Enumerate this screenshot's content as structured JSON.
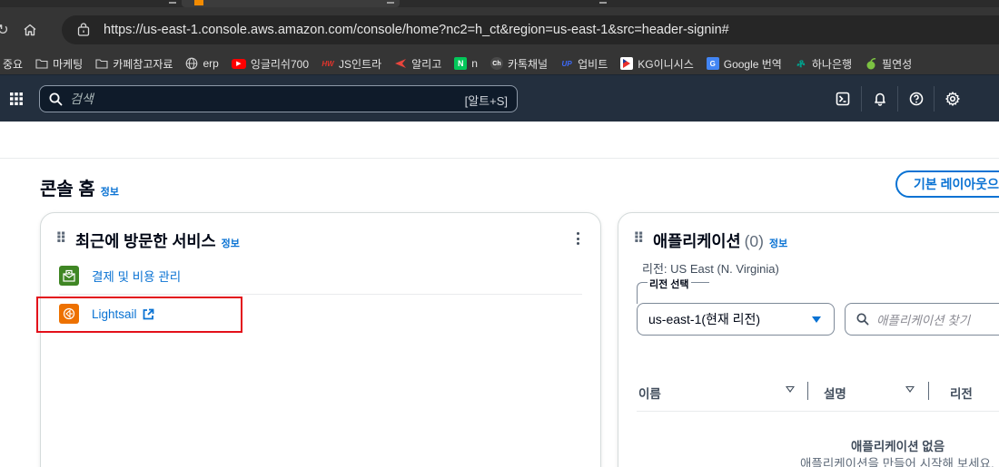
{
  "browser": {
    "url": "https://us-east-1.console.aws.amazon.com/console/home?nc2=h_ct&region=us-east-1&src=header-signin#",
    "bookmarks": [
      {
        "label": "중요",
        "icon": "none"
      },
      {
        "label": "마케팅",
        "icon": "folder-icon"
      },
      {
        "label": "카페참고자료",
        "icon": "folder-icon"
      },
      {
        "label": "erp",
        "icon": "globe-icon"
      },
      {
        "label": "잉글리쉬700",
        "icon": "youtube-icon"
      },
      {
        "label": "JS인트라",
        "icon": "hiworks-icon"
      },
      {
        "label": "알리고",
        "icon": "aligo-icon"
      },
      {
        "label": "n",
        "icon": "naver-icon"
      },
      {
        "label": "카톡채널",
        "icon": "kakao-channel-icon"
      },
      {
        "label": "업비트",
        "icon": "upbit-icon"
      },
      {
        "label": "KG이니시스",
        "icon": "kg-inicis-icon"
      },
      {
        "label": "Google 번역",
        "icon": "google-translate-icon"
      },
      {
        "label": "하나은행",
        "icon": "hana-bank-icon"
      },
      {
        "label": "필연성",
        "icon": "leaf-icon"
      }
    ]
  },
  "aws_nav": {
    "search_placeholder": "검색",
    "search_shortcut": "[알트+S]",
    "icons": [
      "cloudshell-icon",
      "bell-icon",
      "help-icon",
      "gear-icon"
    ]
  },
  "page": {
    "title": "콘솔 홈",
    "info": "정보",
    "layout_button": "기본 레이아웃으로"
  },
  "recent_services": {
    "title": "최근에 방문한 서비스",
    "info": "정보",
    "items": [
      {
        "label": "결제 및 비용 관리",
        "icon": "billing-icon",
        "color": "#3f8624"
      },
      {
        "label": "Lightsail",
        "icon": "lightsail-icon",
        "color": "#ed7100",
        "external": true
      }
    ]
  },
  "applications": {
    "title": "애플리케이션",
    "count": "(0)",
    "info": "정보",
    "region_label": "리전: US East (N. Virginia)",
    "region_select_label": "리전 선택",
    "region_value": "us-east-1(현재 리전)",
    "search_placeholder": "애플리케이션 찾기",
    "columns": [
      "이름",
      "설명",
      "리전"
    ],
    "empty_title": "애플리케이션 없음",
    "empty_sub": "애플리케이션을 만들어 시작해 보세요."
  },
  "colors": {
    "aws_nav_bg": "#232f3e",
    "link": "#0972d3",
    "highlight_box": "#e3101a"
  }
}
